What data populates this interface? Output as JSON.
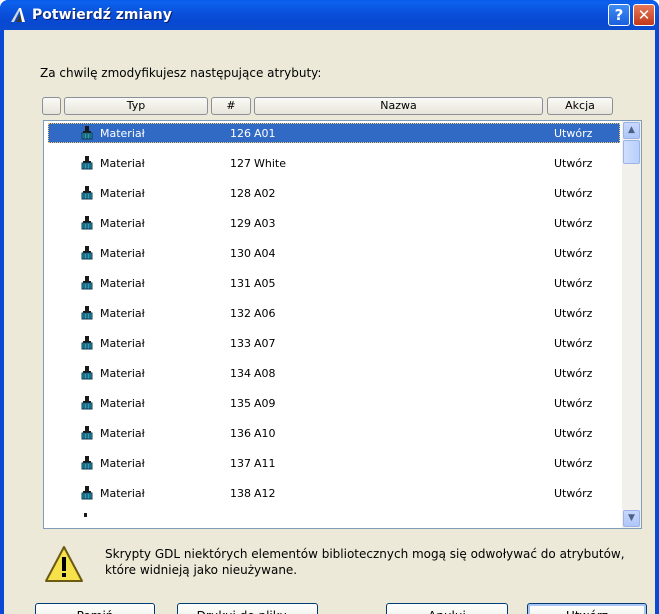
{
  "window": {
    "title": "Potwierdź zmiany",
    "help_label": "?",
    "close_label": "✕"
  },
  "prompt": "Za chwilę zmodyfikujesz następujące atrybuty:",
  "columns": {
    "check": "",
    "type": "Typ",
    "number": "#",
    "name": "Nazwa",
    "action": "Akcja"
  },
  "rows": [
    {
      "type": "Materiał",
      "num": "126",
      "name": "A01",
      "action": "Utwórz",
      "selected": true
    },
    {
      "type": "Materiał",
      "num": "127",
      "name": "White",
      "action": "Utwórz"
    },
    {
      "type": "Materiał",
      "num": "128",
      "name": "A02",
      "action": "Utwórz"
    },
    {
      "type": "Materiał",
      "num": "129",
      "name": "A03",
      "action": "Utwórz"
    },
    {
      "type": "Materiał",
      "num": "130",
      "name": "A04",
      "action": "Utwórz"
    },
    {
      "type": "Materiał",
      "num": "131",
      "name": "A05",
      "action": "Utwórz"
    },
    {
      "type": "Materiał",
      "num": "132",
      "name": "A06",
      "action": "Utwórz"
    },
    {
      "type": "Materiał",
      "num": "133",
      "name": "A07",
      "action": "Utwórz"
    },
    {
      "type": "Materiał",
      "num": "134",
      "name": "A08",
      "action": "Utwórz"
    },
    {
      "type": "Materiał",
      "num": "135",
      "name": "A09",
      "action": "Utwórz"
    },
    {
      "type": "Materiał",
      "num": "136",
      "name": "A10",
      "action": "Utwórz"
    },
    {
      "type": "Materiał",
      "num": "137",
      "name": "A11",
      "action": "Utwórz"
    },
    {
      "type": "Materiał",
      "num": "138",
      "name": "A12",
      "action": "Utwórz"
    }
  ],
  "warning": "Skrypty GDL niektórych elementów bibliotecznych mogą się odwoływać do atrybutów, które widnieją jako nieużywane.",
  "buttons": {
    "skip": "Pomiń",
    "print": "Drukuj do pliku...",
    "cancel": "Anuluj",
    "create": "Utwórz"
  },
  "icons": {
    "row_icon": "material-brush-icon",
    "warning": "warning-triangle-icon"
  },
  "colors": {
    "selection": "#316ac5",
    "titlebar": "#0a52dc",
    "dialog_bg": "#ece9d8"
  }
}
